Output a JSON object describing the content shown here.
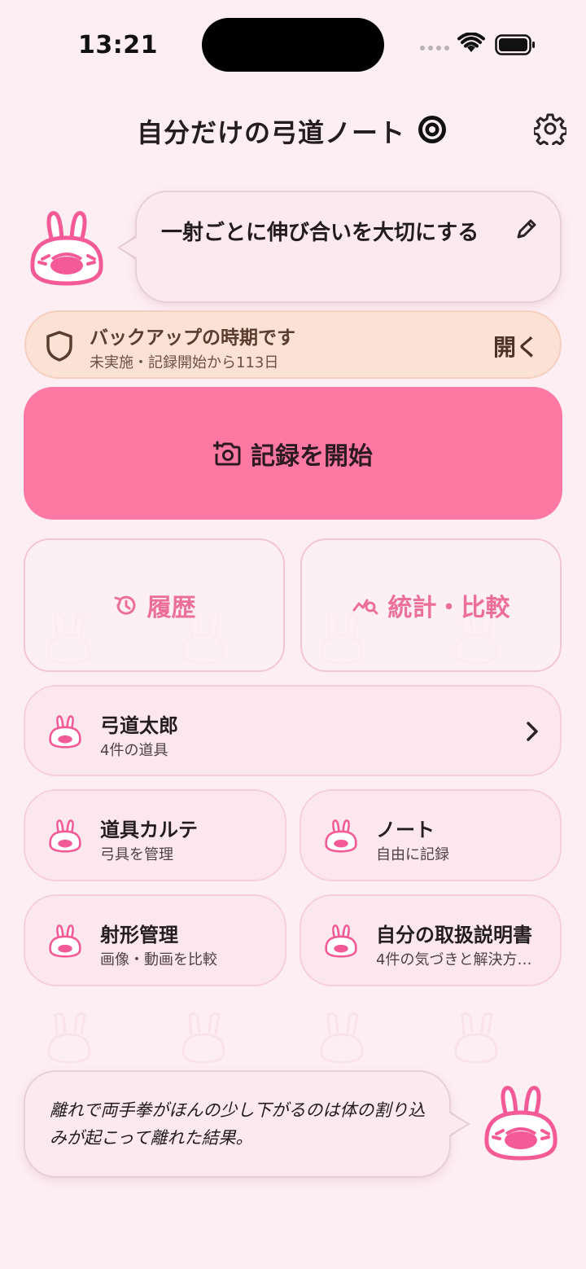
{
  "status_bar": {
    "time": "13:21"
  },
  "header": {
    "title": "自分だけの弓道ノート",
    "target_icon": "target-icon",
    "settings_icon": "gear-icon"
  },
  "motto": {
    "text": "一射ごとに伸び合いを大切にする",
    "edit_icon": "pencil-icon"
  },
  "backup": {
    "title": "バックアップの時期です",
    "subtitle": "未実施・記録開始から113日",
    "action": "開く",
    "icon": "shield-icon"
  },
  "start_button": {
    "label": "記録を開始",
    "icon": "camera-add-icon"
  },
  "nav_cards": {
    "history": {
      "label": "履歴",
      "icon": "history-icon"
    },
    "stats": {
      "label": "統計・比較",
      "icon": "chart-search-icon"
    }
  },
  "profile_card": {
    "title": "弓道太郎",
    "subtitle": "4件の道具"
  },
  "menu_cards": [
    {
      "title": "道具カルテ",
      "subtitle": "弓具を管理"
    },
    {
      "title": "ノート",
      "subtitle": "自由に記録"
    },
    {
      "title": "射形管理",
      "subtitle": "画像・動画を比較"
    },
    {
      "title": "自分の取扱説明書",
      "subtitle": "4件の気づきと解決方…"
    }
  ],
  "tip": {
    "text": "離れで両手拳がほんの少し下がるのは体の割り込みが起こって離れた結果。"
  },
  "colors": {
    "accent": "#fd79a4",
    "background": "#fdeef3",
    "card": "#fce7ee",
    "backup_bg": "#fbe2d5",
    "bunny": "#f45b96"
  }
}
